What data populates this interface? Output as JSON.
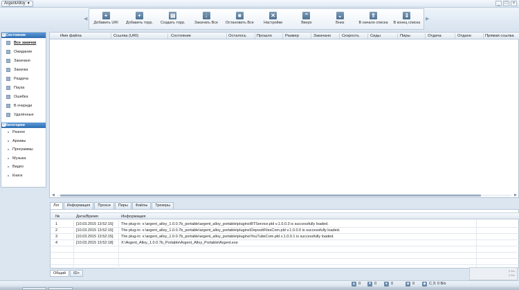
{
  "app": {
    "menu_label": "ArgentAlloy",
    "window_controls": [
      "_",
      "□",
      "×"
    ]
  },
  "toolbar": {
    "buttons": [
      {
        "label": "Добавить URI",
        "icon": "plus-icon"
      },
      {
        "label": "Добавить торр.",
        "icon": "add-torrent-icon"
      },
      {
        "label": "Создать торр.",
        "icon": "create-torrent-icon"
      },
      {
        "label": "Закачать Все",
        "icon": "download-all-icon"
      },
      {
        "label": "Остановить Все",
        "icon": "stop-all-icon"
      },
      {
        "label": "Настройки",
        "icon": "settings-icon"
      },
      {
        "label": "Вверх",
        "icon": "chevron-up-icon"
      },
      {
        "label": "Вниз",
        "icon": "chevron-down-icon"
      },
      {
        "label": "В начало списка",
        "icon": "move-top-icon"
      },
      {
        "label": "В конец списка",
        "icon": "move-bottom-icon"
      }
    ]
  },
  "sidebar": {
    "state_header": "Состояние",
    "state_items": [
      {
        "label": "Все закачки",
        "active": true
      },
      {
        "label": "Ожидание",
        "active": false
      },
      {
        "label": "Закачано",
        "active": false
      },
      {
        "label": "Закачка",
        "active": false
      },
      {
        "label": "Раздача",
        "active": false
      },
      {
        "label": "Пауза",
        "active": false
      },
      {
        "label": "Ошибка",
        "active": false
      },
      {
        "label": "В очереди",
        "active": false
      },
      {
        "label": "Удалённые",
        "active": false
      }
    ],
    "category_header": "Категории",
    "category_items": [
      "Разное",
      "Архивы",
      "Программы",
      "Музыка",
      "Видео",
      "Книги"
    ]
  },
  "downloads_table": {
    "columns": [
      "Имя файла",
      "Ссылка (URI)",
      "Состояние",
      "Осталось",
      "Прошло",
      "Размер",
      "Закачано",
      "Скорость",
      "Сиды",
      "Пиры",
      "Отдача",
      "Отдано",
      "Прямая ссылка"
    ]
  },
  "log_tabs": [
    "Лог",
    "Информация",
    "Прокси",
    "Пиры",
    "Файлы",
    "Трекеры"
  ],
  "log": {
    "columns": [
      "№",
      "Дата/Время",
      "Информация"
    ],
    "rows": [
      {
        "n": "1",
        "time": "[10.03.2015 13:52:15]",
        "info": "The plug-in: x:\\argent_alloy_1.0.0.7b_portable\\argent_alloy_portable\\plugins\\BTService.pld v.1.0.0.3 is successfully loaded."
      },
      {
        "n": "2",
        "time": "[10.03.2015 13:52:15]",
        "info": "The plug-in: x:\\argent_alloy_1.0.0.7b_portable\\argent_alloy_portable\\plugins\\DepositFilesCom.pld v.1.0.0.0 is successfully loaded."
      },
      {
        "n": "3",
        "time": "[10.03.2015 13:52:15]",
        "info": "The plug-in: x:\\argent_alloy_1.0.0.7b_portable\\argent_alloy_portable\\plugins\\YouTubeCom.pld v.1.0.0.1 is successfully loaded."
      },
      {
        "n": "4",
        "time": "[10.03.2015 13:52:18]",
        "info": "X:\\Argent_Alloy_1.0.0.7b_Portable\\Argent_Alloy_Portable\\Argent.exe"
      }
    ]
  },
  "bottom_tabs": [
    "Общий",
    "ID>"
  ],
  "statusbar": {
    "up_count": "0",
    "down_count": "0",
    "active_count": "0",
    "done_count": "0",
    "speed": "С.З: 0 B/s"
  },
  "speed_widget": {
    "line1": "0 B/s",
    "line2": "0 B/s"
  }
}
